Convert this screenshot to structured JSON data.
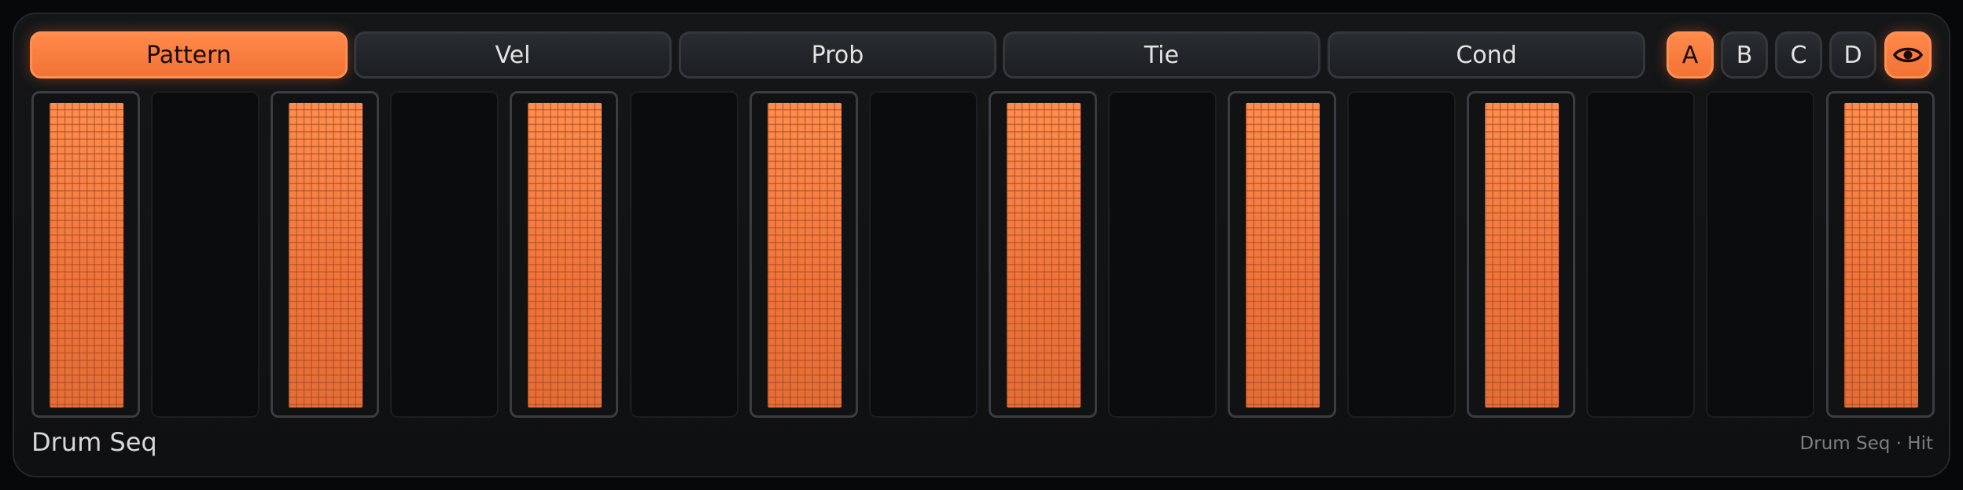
{
  "tabs": [
    "Pattern",
    "Vel",
    "Prob",
    "Tie",
    "Cond"
  ],
  "active_tab": 0,
  "banks": [
    "A",
    "B",
    "C",
    "D"
  ],
  "active_bank": 0,
  "view_button": {
    "icon": "eye-icon",
    "active": true
  },
  "steps": [
    true,
    false,
    true,
    false,
    true,
    false,
    true,
    false,
    true,
    false,
    true,
    false,
    true,
    false,
    false,
    true
  ],
  "footer": {
    "title": "Drum Seq",
    "status": "Drum Seq · Hit"
  },
  "colors": {
    "accent": "#ff7d3f",
    "panel": "#111315",
    "button": "#25282c"
  }
}
